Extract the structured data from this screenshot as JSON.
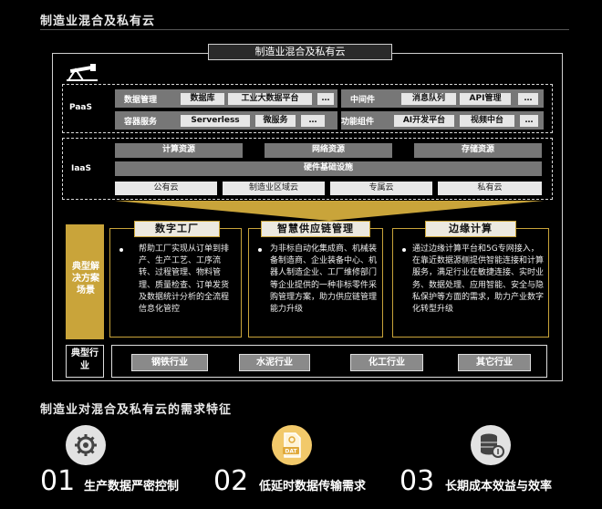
{
  "section1_title": "制造业混合及私有云",
  "diagram_title": "制造业混合及私有云",
  "paas": {
    "label": "PaaS",
    "row1_left_label": "数据管理",
    "row1_left_chips": [
      "数据库",
      "工业大数据平台",
      "…"
    ],
    "row1_right_label": "中间件",
    "row1_right_chips": [
      "消息队列",
      "API管理",
      "…"
    ],
    "row2_left_label": "容器服务",
    "row2_left_chips": [
      "Serverless",
      "微服务",
      "…"
    ],
    "row2_right_label": "功能组件",
    "row2_right_chips": [
      "AI开发平台",
      "视频中台",
      "…"
    ]
  },
  "iaas": {
    "label": "IaaS",
    "resources": [
      "计算资源",
      "网络资源",
      "存储资源"
    ],
    "infrastructure": "硬件基础设施",
    "clouds": [
      "公有云",
      "制造业区域云",
      "专属云",
      "私有云"
    ]
  },
  "scenarios": {
    "label": "典型解决方案场景",
    "panels": [
      {
        "title": "数字工厂",
        "text": "帮助工厂实现从订单到排产、生产工艺、工序流转、过程管理、物料管理、质量检查、订单发货及数据统计分析的全流程信息化管控"
      },
      {
        "title": "智慧供应链管理",
        "text": "为非标自动化集成商、机械装备制造商、企业装备中心、机器人制造企业、工厂维修部门等企业提供的一种非标零件采购管理方案，助力供应链管理能力升级"
      },
      {
        "title": "边缘计算",
        "text": "通过边缘计算平台和5G专网接入，在靠近数据源侧提供智能连接和计算服务，满足行业在敏捷连接、实时业务、数据处理、应用智能、安全与隐私保护等方面的需求，助力产业数字化转型升级"
      }
    ]
  },
  "industries": {
    "label": "典型行业",
    "items": [
      "钢铁行业",
      "水泥行业",
      "化工行业",
      "其它行业"
    ]
  },
  "section2_title": "制造业对混合及私有云的需求特征",
  "features": [
    {
      "num": "01",
      "text": "生产数据严密控制",
      "icon": "gear-icon"
    },
    {
      "num": "02",
      "text": "低延时数据传输需求",
      "icon": "dat-file-icon"
    },
    {
      "num": "03",
      "text": "长期成本效益与效率",
      "icon": "database-icon"
    }
  ],
  "colors": {
    "accent_gold": "#c9a43a",
    "panel_bg": "#ece9e0",
    "gray_box": "#777777"
  }
}
